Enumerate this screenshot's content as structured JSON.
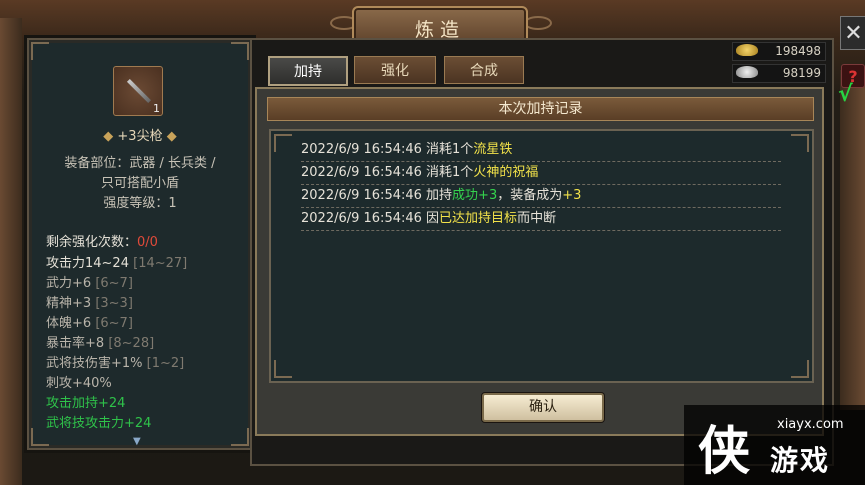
{
  "window": {
    "title": "炼造"
  },
  "currency": {
    "gold": "198498",
    "silver": "98199"
  },
  "tabs": [
    {
      "label": "加持",
      "active": true
    },
    {
      "label": "强化",
      "active": false
    },
    {
      "label": "合成",
      "active": false
    }
  ],
  "item": {
    "count": "1",
    "name": "+3尖枪",
    "slot_line1": "装备部位：武器 / 长兵类 /",
    "slot_line2": "只可搭配小盾",
    "strength": "强度等级：1"
  },
  "stats": {
    "remain_label": "剩余强化次数：",
    "remain_value": "0/0",
    "attack_label": "攻击力14~24",
    "attack_range": "[14~27]",
    "wuli": "武力+6",
    "wuli_range": "[6~7]",
    "jingshen": "精神+3",
    "jingshen_range": "[3~3]",
    "tipo": "体魄+6",
    "tipo_range": "[6~7]",
    "crit": "暴击率+8",
    "crit_range": "[8~28]",
    "skill_dmg": "武将技伤害+1%",
    "skill_dmg_range": "[1~2]",
    "pierce": "刺攻+40%",
    "atk_bonus": "攻击加持+24",
    "skill_atk": "武将技攻击力+24"
  },
  "dialog": {
    "title": "本次加持记录",
    "log": [
      {
        "prefix": "2022/6/9 16:54:46 消耗1个",
        "hl": "流星铁",
        "hl_color": "yellow",
        "suffix": ""
      },
      {
        "prefix": "2022/6/9 16:54:46 消耗1个",
        "hl": "火神的祝福",
        "hl_color": "yellow",
        "suffix": ""
      },
      {
        "prefix": "2022/6/9 16:54:46 加持",
        "hl": "成功+3",
        "hl_color": "green",
        "suffix": "，装备成为",
        "hl2": "+3"
      },
      {
        "prefix": "2022/6/9 16:54:46 因",
        "hl": "已达加持目标",
        "hl_color": "yellow",
        "suffix": "而中断"
      }
    ],
    "ok_label": "确认"
  },
  "watermark": {
    "glyph": "侠",
    "url": "xiayx.com",
    "text": "游戏"
  },
  "colors": {
    "highlight_yellow": "#f2e24a",
    "highlight_green": "#35d34e",
    "remain_red": "#e04a3a"
  }
}
